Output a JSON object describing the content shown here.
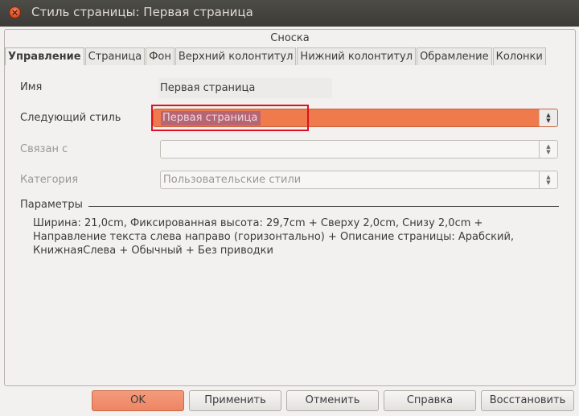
{
  "window": {
    "title": "Стиль страницы: Первая страница",
    "close_icon": "close-icon"
  },
  "tabs": {
    "top_row": [
      "Сноска"
    ],
    "row": [
      {
        "label": "Управление",
        "active": true
      },
      {
        "label": "Страница",
        "active": false
      },
      {
        "label": "Фон",
        "active": false
      },
      {
        "label": "Верхний колонтитул",
        "active": false
      },
      {
        "label": "Нижний колонтитул",
        "active": false
      },
      {
        "label": "Обрамление",
        "active": false
      },
      {
        "label": "Колонки",
        "active": false
      }
    ]
  },
  "form": {
    "name_label": "Имя",
    "name_value": "Первая страница",
    "next_style_label": "Следующий стиль",
    "next_style_value": "Первая страница",
    "linked_label": "Связан с",
    "linked_value": "",
    "category_label": "Категория",
    "category_value": "Пользовательские стили"
  },
  "parameters": {
    "title": "Параметры",
    "text": "Ширина: 21,0cm, Фиксированная высота: 29,7cm + Сверху 2,0cm, Снизу 2,0cm + Направление текста слева направо (горизонтально) + Описание страницы: Арабский, КнижнаяСлева + Обычный + Без приводки"
  },
  "buttons": {
    "ok": "OK",
    "apply": "Применить",
    "cancel": "Отменить",
    "help": "Справка",
    "reset": "Восстановить"
  },
  "colors": {
    "accent": "#ef7a4c",
    "selection": "#b86573",
    "highlight_box": "#e0101e",
    "titlebar": "#3c3b37"
  }
}
